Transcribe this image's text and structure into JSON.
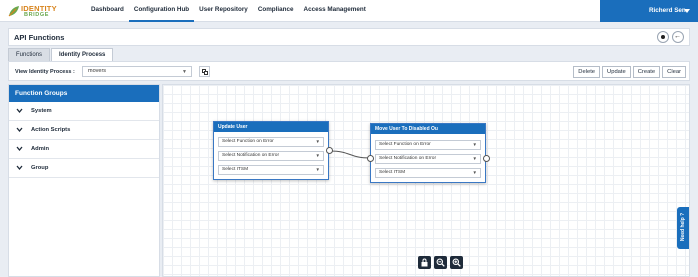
{
  "logo": {
    "line1": "IDENTITY",
    "line2": "BRIDGE"
  },
  "nav": {
    "items": [
      "Dashboard",
      "Configuration Hub",
      "User Repository",
      "Compliance",
      "Access Management"
    ],
    "active": "Configuration Hub"
  },
  "user": {
    "name": "Richerd Sen"
  },
  "page": {
    "title": "API Functions"
  },
  "tabs": [
    {
      "label": "Functions"
    },
    {
      "label": "Identity Process"
    }
  ],
  "toolbar": {
    "label": "View Identity Process :",
    "selected": "movers",
    "buttons": [
      "Delete",
      "Update",
      "Create",
      "Clear"
    ]
  },
  "sidebar": {
    "title": "Function Groups",
    "groups": [
      "System",
      "Action Scripts",
      "Admin",
      "Group"
    ]
  },
  "canvas": {
    "nodes": [
      {
        "title": "Update User",
        "selects": [
          "Select Function on Error",
          "Select Notification on Error",
          "Select ITSM"
        ]
      },
      {
        "title": "Move User To Disabled Ou",
        "selects": [
          "Select Function on Error",
          "Select Notification on Error",
          "Select ITSM"
        ]
      }
    ],
    "help": "Need help ?"
  },
  "icons": {
    "brand_color": "#1a6ebc",
    "toolbar_icons": [
      "copy-icon"
    ],
    "header_icons": [
      "record-icon",
      "back-arrow-icon"
    ],
    "zoom_icons": [
      "lock-icon",
      "zoom-out-icon",
      "zoom-in-icon"
    ]
  }
}
